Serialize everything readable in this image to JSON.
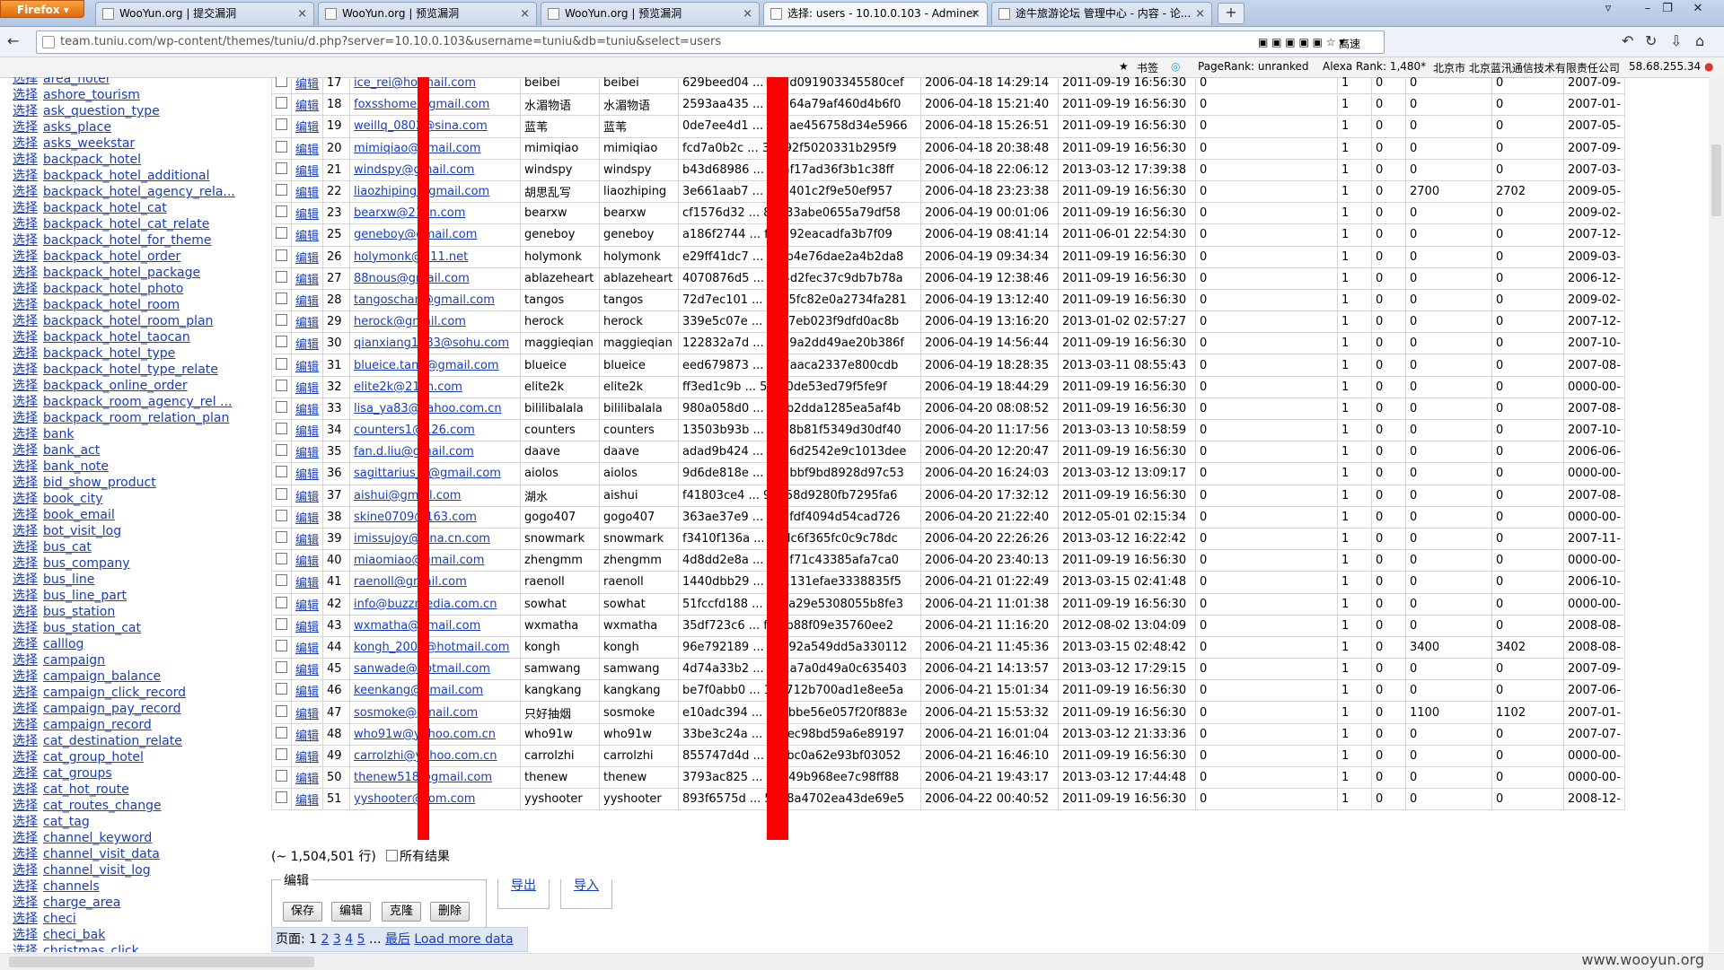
{
  "browser": {
    "app_button": "Firefox",
    "tabs": [
      {
        "title": "WooYun.org | 提交漏洞",
        "active": false
      },
      {
        "title": "WooYun.org | 预览漏洞",
        "active": false
      },
      {
        "title": "WooYun.org | 预览漏洞",
        "active": false
      },
      {
        "title": "选择: users - 10.10.0.103 - Adminer",
        "active": true
      },
      {
        "title": "途牛旅游论坛 管理中心 - 内容 - 论...",
        "active": false
      }
    ],
    "new_tab": "+",
    "url": "team.tuniu.com/wp-content/themes/tuniu/d.php?server=10.10.0.103&username=tuniu&db=tuniu&select=users",
    "search_engine_label": "高速"
  },
  "addon_bar": {
    "bookmarks": "书签",
    "pagerank": "PageRank: unranked",
    "alexa": "Alexa Rank: 1,480*",
    "isp": "北京市 北京蓝汛通信技术有限责任公司",
    "ip": "58.68.255.34"
  },
  "sidebar": {
    "select_label": "选择",
    "tables": [
      "area_hotel",
      "ashore_tourism",
      "ask_question_type",
      "asks_place",
      "asks_weekstar",
      "backpack_hotel",
      "backpack_hotel_additional",
      "backpack_hotel_agency_rela...",
      "backpack_hotel_cat",
      "backpack_hotel_cat_relate",
      "backpack_hotel_for_theme",
      "backpack_hotel_order",
      "backpack_hotel_package",
      "backpack_hotel_photo",
      "backpack_hotel_room",
      "backpack_hotel_room_plan",
      "backpack_hotel_taocan",
      "backpack_hotel_type",
      "backpack_hotel_type_relate",
      "backpack_online_order",
      "backpack_room_agency_rel ...",
      "backpack_room_relation_plan",
      "bank",
      "bank_act",
      "bank_note",
      "bid_show_product",
      "book_city",
      "book_email",
      "bot_visit_log",
      "bus_cat",
      "bus_company",
      "bus_line",
      "bus_line_part",
      "bus_station",
      "bus_station_cat",
      "calllog",
      "campaign",
      "campaign_balance",
      "campaign_click_record",
      "campaign_pay_record",
      "campaign_record",
      "cat_destination_relate",
      "cat_group_hotel",
      "cat_groups",
      "cat_hot_route",
      "cat_routes_change",
      "cat_tag",
      "channel_keyword",
      "channel_visit_data",
      "channel_visit_log",
      "channels",
      "charge_area",
      "checi",
      "checi_bak",
      "christmas_click"
    ]
  },
  "table": {
    "edit_label": "编辑",
    "rows": [
      [
        "17",
        "ice_rei@hotmail.com",
        "beibei",
        "beibei",
        "629beed04 ... 441d091903345580cef",
        "2006-04-18 14:29:14",
        "2011-09-19 16:56:30",
        "0",
        "1",
        "0",
        "0",
        "0",
        "2007-09-"
      ],
      [
        "18",
        "foxsshome@gmail.com",
        "水湄物语",
        "水湄物语",
        "2593aa435 ... e7464a79af460d4b6f0",
        "2006-04-18 15:21:40",
        "2011-09-19 16:56:30",
        "0",
        "1",
        "0",
        "0",
        "0",
        "2007-01-"
      ],
      [
        "19",
        "weillq_0802@sina.com",
        "蓝苇",
        "蓝苇",
        "0de7ee4d1 ... 938ae456758d34e5966",
        "2006-04-18 15:26:51",
        "2011-09-19 16:56:30",
        "0",
        "1",
        "0",
        "0",
        "0",
        "2007-05-"
      ],
      [
        "20",
        "mimiqiao@gmail.com",
        "mimiqiao",
        "mimiqiao",
        "fcd7a0b2c ... 38592f5020331b295f9",
        "2006-04-18 20:38:48",
        "2011-09-19 16:56:30",
        "0",
        "1",
        "0",
        "0",
        "0",
        "2007-09-"
      ],
      [
        "21",
        "windspy@gmail.com",
        "windspy",
        "windspy",
        "b43d68986 ... 66af17ad36f3b1c38ff",
        "2006-04-18 22:06:12",
        "2013-03-12 17:39:38",
        "0",
        "1",
        "0",
        "0",
        "0",
        "2007-03-"
      ],
      [
        "22",
        "liaozhiping@gmail.com",
        "胡思乱写",
        "liaozhiping",
        "3e661aab7 ... 359401c2f9e50ef957",
        "2006-04-18 23:23:38",
        "2011-09-19 16:56:30",
        "0",
        "1",
        "0",
        "2700",
        "2702",
        "2009-05-"
      ],
      [
        "23",
        "bearxw@21cn.com",
        "bearxw",
        "bearxw",
        "cf1576d32 ... 85833abe0655a79df58",
        "2006-04-19 00:01:06",
        "2011-09-19 16:56:30",
        "0",
        "1",
        "0",
        "0",
        "0",
        "2009-02-"
      ],
      [
        "25",
        "geneboy@gmail.com",
        "geneboy",
        "geneboy",
        "a186f2744 ... f4c792eacadfa3b7f09",
        "2006-04-19 08:41:14",
        "2011-06-01 22:54:30",
        "0",
        "1",
        "0",
        "0",
        "0",
        "2007-12-"
      ],
      [
        "26",
        "holymonk@911.net",
        "holymonk",
        "holymonk",
        "e29ff41dc7 ... 10fb4e76dae2a4b2da8",
        "2006-04-19 09:34:34",
        "2011-09-19 16:56:30",
        "0",
        "1",
        "0",
        "0",
        "0",
        "2009-03-"
      ],
      [
        "27",
        "88nous@gmail.com",
        "ablazeheart",
        "ablazeheart",
        "4070876d5 ... 864d2fec37c9db7b78a",
        "2006-04-19 12:38:46",
        "2011-09-19 16:56:30",
        "0",
        "1",
        "0",
        "0",
        "0",
        "2006-12-"
      ],
      [
        "28",
        "tangoschan@gmail.com",
        "tangos",
        "tangos",
        "72d7ec101 ... 7925fc82e0a2734fa281",
        "2006-04-19 13:12:40",
        "2011-09-19 16:56:30",
        "0",
        "1",
        "0",
        "0",
        "0",
        "2009-02-"
      ],
      [
        "29",
        "herock@gmail.com",
        "herock",
        "herock",
        "339e5c07e ... 2eb7eb023f9dfd0ac8b",
        "2006-04-19 13:16:20",
        "2013-01-02 02:57:27",
        "0",
        "1",
        "0",
        "0",
        "0",
        "2007-12-"
      ],
      [
        "30",
        "qianxiang1983@sohu.com",
        "maggieqian",
        "maggieqian",
        "122832a7d ... 4a39a2dd49ae20b386f",
        "2006-04-19 14:56:44",
        "2011-09-19 16:56:30",
        "0",
        "1",
        "0",
        "0",
        "0",
        "2007-10-"
      ],
      [
        "31",
        "blueice.tang@gmail.com",
        "blueice",
        "blueice",
        "eed679873 ... ffa7aaca2337e800cdb",
        "2006-04-19 18:28:35",
        "2013-03-11 08:55:43",
        "0",
        "1",
        "0",
        "0",
        "0",
        "2007-08-"
      ],
      [
        "32",
        "elite2k@21cn.com",
        "elite2k",
        "elite2k",
        "ff3ed1c9b ... 5f350de53ed79f5fe9f",
        "2006-04-19 18:44:29",
        "2011-09-19 16:56:30",
        "0",
        "1",
        "0",
        "0",
        "0",
        "0000-00-"
      ],
      [
        "33",
        "lisa_ya83@yahoo.com.cn",
        "bililibalala",
        "bililibalala",
        "980a058d0 ... 55fb2dda1285ea5af4b",
        "2006-04-20 08:08:52",
        "2011-09-19 16:56:30",
        "0",
        "1",
        "0",
        "0",
        "0",
        "2007-08-"
      ],
      [
        "34",
        "counters1@126.com",
        "counters",
        "counters",
        "13503b93b ... 5c38b81f5349d30df40",
        "2006-04-20 11:17:56",
        "2013-03-13 10:58:59",
        "0",
        "1",
        "0",
        "0",
        "0",
        "2007-10-"
      ],
      [
        "35",
        "fan.d.liu@gmail.com",
        "daave",
        "daave",
        "adad9b424 ... e686d2542e9c1013dee",
        "2006-04-20 12:20:47",
        "2011-09-19 16:56:30",
        "0",
        "1",
        "0",
        "0",
        "0",
        "2006-06-"
      ],
      [
        "36",
        "sagittarius_y@gmail.com",
        "aiolos",
        "aiolos",
        "9d6de818e ... d93bbf9bd8928d97c53",
        "2006-04-20 16:24:03",
        "2013-03-12 13:09:17",
        "0",
        "1",
        "0",
        "0",
        "0",
        "0000-00-"
      ],
      [
        "37",
        "aishui@gmail.com",
        "湖水",
        "aishui",
        "f41803ce4 ... 93858d9280fb7295fa6",
        "2006-04-20 17:32:12",
        "2011-09-19 16:56:30",
        "0",
        "1",
        "0",
        "0",
        "0",
        "2007-08-"
      ],
      [
        "38",
        "skine0709@163.com",
        "gogo407",
        "gogo407",
        "363ae37e9 ... 411fdf4094d54cad726",
        "2006-04-20 21:22:40",
        "2012-05-01 02:15:34",
        "0",
        "1",
        "0",
        "0",
        "0",
        "0000-00-"
      ],
      [
        "39",
        "imissujoy@sina.cn.com",
        "snowmark",
        "snowmark",
        "f3410f136a ... 3bdc6f365fc0c9c78dc",
        "2006-04-20 22:26:26",
        "2013-03-12 16:22:42",
        "0",
        "1",
        "0",
        "0",
        "0",
        "2007-11-"
      ],
      [
        "40",
        "miaomiao@gmail.com",
        "zhengmm",
        "zhengmm",
        "4d8dd2e8a ... d25f71c43385afa7ca0",
        "2006-04-20 23:40:13",
        "2011-09-19 16:56:30",
        "0",
        "1",
        "0",
        "0",
        "0",
        "0000-00-"
      ],
      [
        "41",
        "raenoll@gmail.com",
        "raenoll",
        "raenoll",
        "1440dbb29 ... b71131efae3338835f5",
        "2006-04-21 01:22:49",
        "2013-03-15 02:41:48",
        "0",
        "1",
        "0",
        "0",
        "0",
        "2006-10-"
      ],
      [
        "42",
        "info@buzzmedia.com.cn",
        "sowhat",
        "sowhat",
        "51fccfd188 ... 4a8a29e5308055b8fe3",
        "2006-04-21 11:01:38",
        "2011-09-19 16:56:30",
        "0",
        "1",
        "0",
        "0",
        "0",
        "0000-00-"
      ],
      [
        "43",
        "wxmatha@gmail.com",
        "wxmatha",
        "wxmatha",
        "35df723c6 ... ffa6b88f09e35760ee2",
        "2006-04-21 11:16:20",
        "2012-08-02 13:04:09",
        "0",
        "1",
        "0",
        "0",
        "0",
        "2008-08-"
      ],
      [
        "44",
        "kongh_2008@hotmail.com",
        "kongh",
        "kongh",
        "96e792189 ... 72c92a549dd5a330112",
        "2006-04-21 11:45:36",
        "2013-03-15 02:48:42",
        "0",
        "1",
        "0",
        "3400",
        "3402",
        "2008-08-"
      ],
      [
        "45",
        "sanwade@hotmail.com",
        "samwang",
        "samwang",
        "4d74a33b2 ... 941a7a0d49a0c635403",
        "2006-04-21 14:13:57",
        "2013-03-12 17:29:15",
        "0",
        "1",
        "0",
        "0",
        "0",
        "2007-09-"
      ],
      [
        "46",
        "keenkang@gmail.com",
        "kangkang",
        "kangkang",
        "be7f0abb0 ... 14a712b700ad1e8ee5a",
        "2006-04-21 15:01:34",
        "2011-09-19 16:56:30",
        "0",
        "1",
        "0",
        "0",
        "0",
        "2007-06-"
      ],
      [
        "47",
        "sosmoke@gmail.com",
        "只好抽烟",
        "sosmoke",
        "e10adc394 ... 59abbe56e057f20f883e",
        "2006-04-21 15:53:32",
        "2011-09-19 16:56:30",
        "0",
        "1",
        "0",
        "1100",
        "1102",
        "2007-01-"
      ],
      [
        "48",
        "who91w@yahoo.com.cn",
        "who91w",
        "who91w",
        "33be3c24a ... 8ceec98bd59a6e89197",
        "2006-04-21 16:01:04",
        "2013-03-12 21:33:36",
        "0",
        "1",
        "0",
        "0",
        "0",
        "2007-07-"
      ],
      [
        "49",
        "carrolzhi@yahoo.com.cn",
        "carrolzhi",
        "carrolzhi",
        "855747d4d ... 44fbc0a62e93bf03052",
        "2006-04-21 16:46:10",
        "2011-09-19 16:56:30",
        "0",
        "1",
        "0",
        "0",
        "0",
        "0000-00-"
      ],
      [
        "50",
        "thenew518@gmail.com",
        "thenew",
        "thenew",
        "3793ac825 ... 67a49b968ee7c98ff88",
        "2006-04-21 19:43:17",
        "2013-03-12 17:44:48",
        "0",
        "1",
        "0",
        "0",
        "0",
        "0000-00-"
      ],
      [
        "51",
        "yyshooter@tom.com",
        "yyshooter",
        "yyshooter",
        "893f6575d ... 5348a4702ea43de69e5",
        "2006-04-22 00:40:52",
        "2011-09-19 16:56:30",
        "0",
        "1",
        "0",
        "0",
        "0",
        "2008-12-"
      ]
    ]
  },
  "results": {
    "count_text": "(~ 1,504,501 行)",
    "all_results_label": "所有结果"
  },
  "edit_panel": {
    "legend": "编辑",
    "save": "保存",
    "edit": "编辑",
    "clone": "克隆",
    "delete": "删除",
    "export": "导出",
    "import": "导入"
  },
  "pager": {
    "label": "页面:",
    "pages": [
      "1",
      "2",
      "3",
      "4",
      "5"
    ],
    "ellipsis": "...",
    "last": "最后",
    "load_more": "Load more data"
  },
  "watermark": "www.wooyun.org",
  "colors": {
    "link": "#1a3db8",
    "redaction": "#ff0000",
    "pager_bg": "#dfe6f4"
  }
}
